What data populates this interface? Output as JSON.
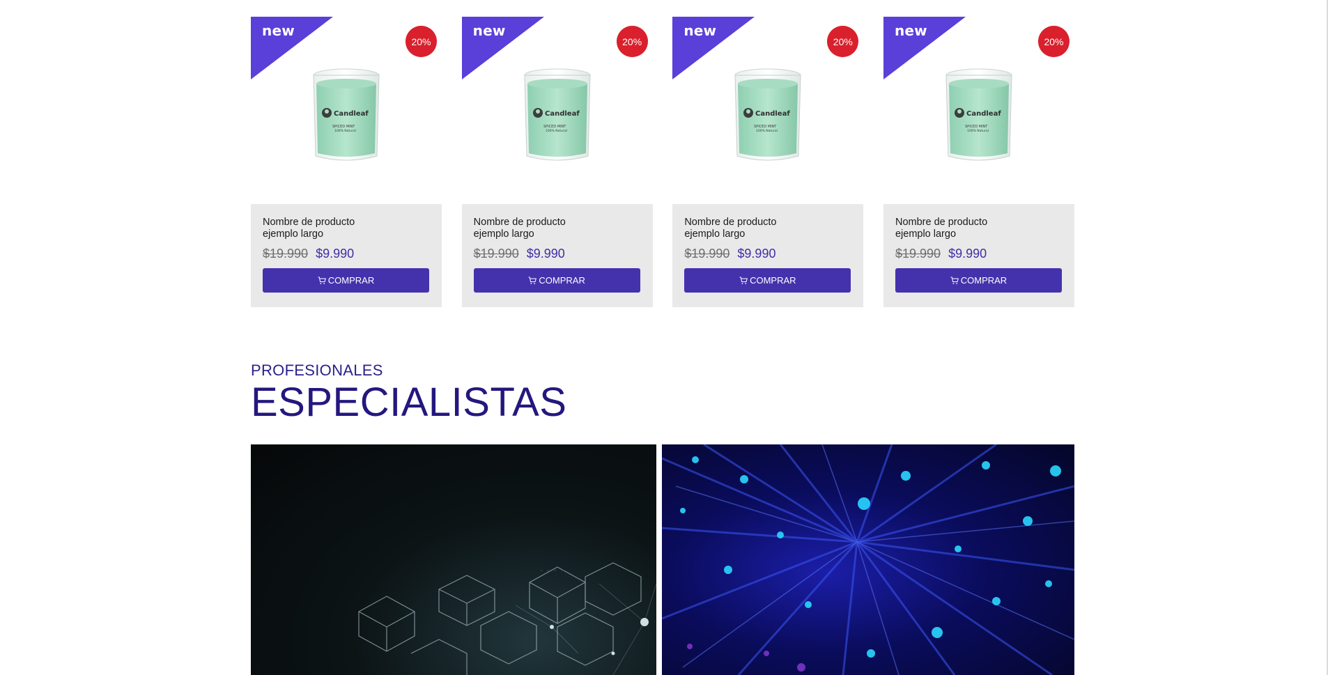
{
  "products": [
    {
      "ribbon": "new",
      "discount": "20%",
      "name": "Nombre de producto ejemplo largo",
      "price_old": "$19.990",
      "price_new": "$9.990",
      "button_label": "COMPRAR",
      "image_brand": "Candleaf",
      "image_variant": "SPICED MINT",
      "image_note": "100% Natural"
    },
    {
      "ribbon": "new",
      "discount": "20%",
      "name": "Nombre de producto ejemplo largo",
      "price_old": "$19.990",
      "price_new": "$9.990",
      "button_label": "COMPRAR",
      "image_brand": "Candleaf",
      "image_variant": "SPICED MINT",
      "image_note": "100% Natural"
    },
    {
      "ribbon": "new",
      "discount": "20%",
      "name": "Nombre de producto ejemplo largo",
      "price_old": "$19.990",
      "price_new": "$9.990",
      "button_label": "COMPRAR",
      "image_brand": "Candleaf",
      "image_variant": "SPICED MINT",
      "image_note": "100% Natural"
    },
    {
      "ribbon": "new",
      "discount": "20%",
      "name": "Nombre de producto ejemplo largo",
      "price_old": "$19.990",
      "price_new": "$9.990",
      "button_label": "COMPRAR",
      "image_brand": "Candleaf",
      "image_variant": "SPICED MINT",
      "image_note": "100% Natural"
    }
  ],
  "specialists_section": {
    "kicker": "PROFESIONALES",
    "title": "ESPECIALISTAS"
  },
  "icons": {
    "cart": "cart-icon",
    "candle_logo": "candleaf-logo-icon"
  },
  "colors": {
    "ribbon": "#5a3fd9",
    "discount_badge": "#d9202c",
    "button": "#4432ad",
    "price_new": "#3f2ea6",
    "heading": "#24177e",
    "card_body": "#e9e9e9"
  }
}
